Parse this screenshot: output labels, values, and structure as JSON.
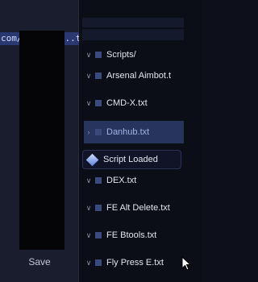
{
  "editor": {
    "code_line": "com/ script...tic",
    "save_label": "Save"
  },
  "explorer": {
    "root_label": "Scripts/",
    "items": [
      {
        "label": "Arsenal Aimbot.t"
      },
      {
        "label": "CMD-X.txt"
      },
      {
        "label": "Danhub.txt",
        "selected": true
      },
      {
        "label": "DEX.txt"
      },
      {
        "label": "FE Alt Delete.txt"
      },
      {
        "label": "FE Btools.txt"
      },
      {
        "label": "Fly Press E.txt"
      }
    ]
  },
  "toast": {
    "text": "Script Loaded"
  },
  "colors": {
    "background": "#0d0f1b",
    "editor_bg": "#1a1d2e",
    "selection": "#2a3872",
    "selected_row": "#27345c",
    "accent_text": "#9fb4ea"
  }
}
